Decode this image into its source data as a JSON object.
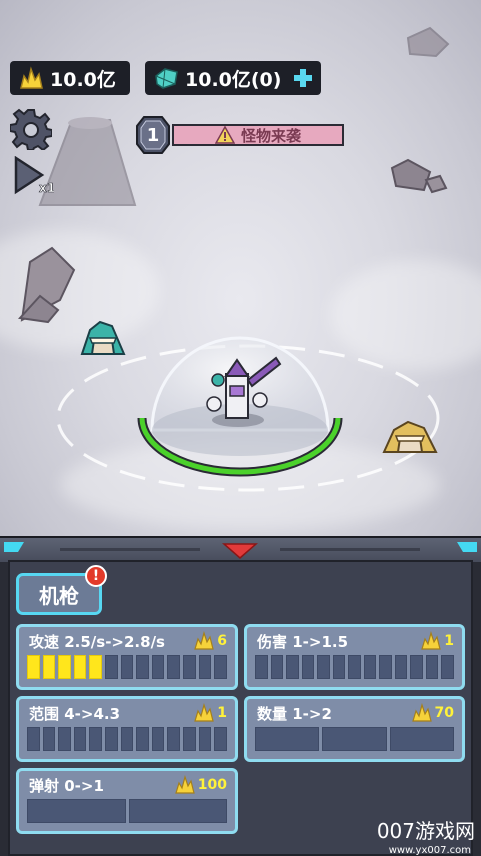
{
  "resources": {
    "gold": "10.0亿",
    "gems": "10.0亿(0)"
  },
  "wave": {
    "number": "1",
    "alert": "怪物来袭"
  },
  "icons": {
    "settings": "gear-icon",
    "speed": "play-speed-icon",
    "gold": "gold-crystal-icon",
    "gem": "gem-icon",
    "add": "plus-icon",
    "warning": "warning-triangle-icon",
    "collapse": "chevron-down-icon"
  },
  "panel": {
    "tab_label": "机枪",
    "tab_badge": "!",
    "upgrades": [
      {
        "label": "攻速 2.5/s->2.8/s",
        "cost": "6",
        "filled": 5,
        "segments": 13
      },
      {
        "label": "伤害 1->1.5",
        "cost": "1",
        "filled": 0,
        "segments": 13
      },
      {
        "label": "范围 4->4.3",
        "cost": "1",
        "filled": 0,
        "segments": 13
      },
      {
        "label": "数量 1->2",
        "cost": "70",
        "filled": 0,
        "segments": 3
      },
      {
        "label": "弹射 0->1",
        "cost": "100",
        "filled": 0,
        "segments": 2
      }
    ]
  },
  "watermark": {
    "main": "007游戏网",
    "url": "www.yx007.com"
  },
  "colors": {
    "accent": "#57d7f2",
    "bar_fill": "#ffe61c",
    "health": "#4bd12b",
    "alert_bg": "#e7a9bf",
    "badge": "#e23a2a"
  }
}
